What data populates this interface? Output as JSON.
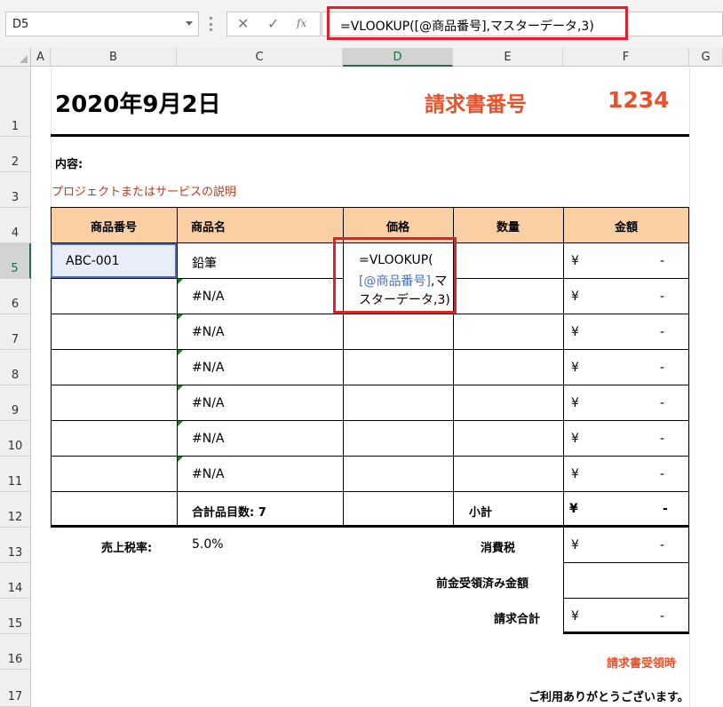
{
  "formula_bar": {
    "cell_ref": "D5",
    "cancel_icon": "✕",
    "enter_icon": "✓",
    "fx_icon": "fx",
    "formula": "=VLOOKUP([@商品番号],マスターデータ,3)"
  },
  "columns": [
    "A",
    "B",
    "C",
    "D",
    "E",
    "F",
    "G"
  ],
  "rows": [
    "1",
    "2",
    "3",
    "4",
    "5",
    "6",
    "7",
    "8",
    "9",
    "10",
    "11",
    "12",
    "13",
    "14",
    "15",
    "16",
    "17"
  ],
  "invoice": {
    "date": "2020年9月2日",
    "number_label": "請求書番号",
    "number_value": "1234",
    "content_label": "内容:",
    "description": "プロジェクトまたはサービスの説明",
    "headers": [
      "商品番号",
      "商品名",
      "価格",
      "数量",
      "金額"
    ],
    "first_item_code": "ABC-001",
    "first_item_name": "鉛筆",
    "cell_formula_line1": "=VLOOKUP(",
    "cell_formula_ref": "[@商品番号]",
    "cell_formula_ref_tail": ",マ",
    "cell_formula_line3": "スターデータ,3)",
    "na": "#N/A",
    "yen": "¥",
    "dash": "-",
    "total_items": "合計品目数: 7",
    "subtotal_label": "小計",
    "tax_rate_label": "売上税率:",
    "tax_rate_value": "5.0%",
    "tax_label": "消費税",
    "prepaid_label": "前金受領済み金額",
    "total_label": "請求合計",
    "receipt_label": "請求書受領時",
    "thanks": "ご利用ありがとうございます。"
  },
  "colors": {
    "accent_red": "#e0202a",
    "title_orange": "#e8512a",
    "header_fill": "#fbcfa4",
    "selection_green": "#217346",
    "description_red": "#c0391b",
    "ref_blue": "#4472c4"
  }
}
